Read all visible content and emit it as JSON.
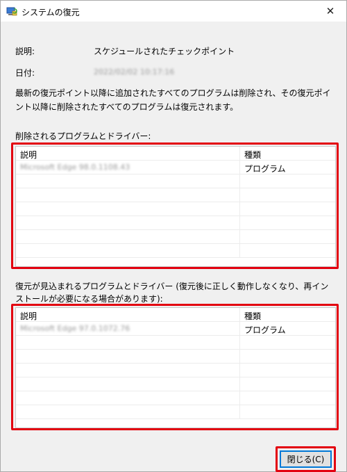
{
  "window": {
    "title": "システムの復元",
    "close_glyph": "✕"
  },
  "details": {
    "description_label": "説明:",
    "description_value": "スケジュールされたチェックポイント",
    "date_label": "日付:",
    "date_value": "2022/02/02 10:17:16"
  },
  "message": "最新の復元ポイント以降に追加されたすべてのプログラムは削除され、その復元ポイント以降に削除されたすべてのプログラムは復元されます。",
  "deleted_section": {
    "label": "削除されるプログラムとドライバー:",
    "col_description": "説明",
    "col_type": "種類",
    "rows": [
      {
        "name": "Microsoft Edge 98.0.1108.43",
        "type": "プログラム"
      }
    ]
  },
  "restored_section": {
    "label": "復元が見込まれるプログラムとドライバー (復元後に正しく動作しなくなり、再インストールが必要になる場合があります):",
    "col_description": "説明",
    "col_type": "種類",
    "rows": [
      {
        "name": "Microsoft Edge 97.0.1072.76",
        "type": "プログラム"
      }
    ]
  },
  "footer": {
    "close_label": "閉じる(C)"
  },
  "colors": {
    "highlight": "#e3000f",
    "focus": "#0078d7"
  }
}
